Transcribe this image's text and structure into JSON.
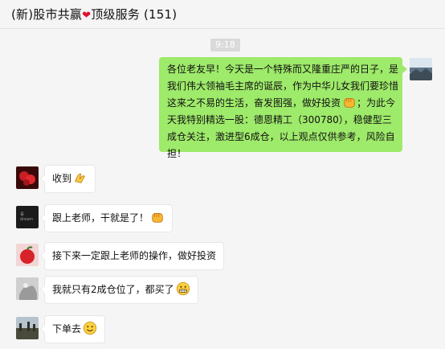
{
  "chat": {
    "title_prefix": "(新)股市共赢",
    "heart": "❤",
    "title_suffix": "顶级服务",
    "member_count": "(151)"
  },
  "time_badge": "9:18",
  "messages": [
    {
      "sender": "self",
      "lines": [
        "各位老友早！今天是一个特殊而又隆重庄严的日子，是",
        "我们伟大领袖毛主席的诞辰，作为中华儿女我们要珍惜",
        "这来之不易的生活，奋发图强，做好投资",
        "；为此今",
        "天我特别精选一股：德恩精工（300780），稳健型三",
        "成仓关注，激进型6成仓，以上观点仅供参考，风险自",
        "担！"
      ],
      "emoji": "fist-emoji"
    },
    {
      "sender": "other",
      "text": "收到",
      "emoji": "hands-emoji"
    },
    {
      "sender": "other",
      "text": "跟上老师，干就是了！",
      "emoji": "fist-emoji"
    },
    {
      "sender": "other",
      "text": "接下来一定跟上老师的操作，做好投资",
      "emoji": ""
    },
    {
      "sender": "other",
      "text": "我就只有2成仓位了，都买了",
      "emoji": "grin-emoji"
    },
    {
      "sender": "other",
      "text": "下单去",
      "emoji": "smile-emoji"
    }
  ],
  "colors": {
    "self_bubble": "#9eea6a",
    "other_bubble": "#ffffff",
    "background": "#f5f5f5",
    "heart": "#e0102b"
  }
}
